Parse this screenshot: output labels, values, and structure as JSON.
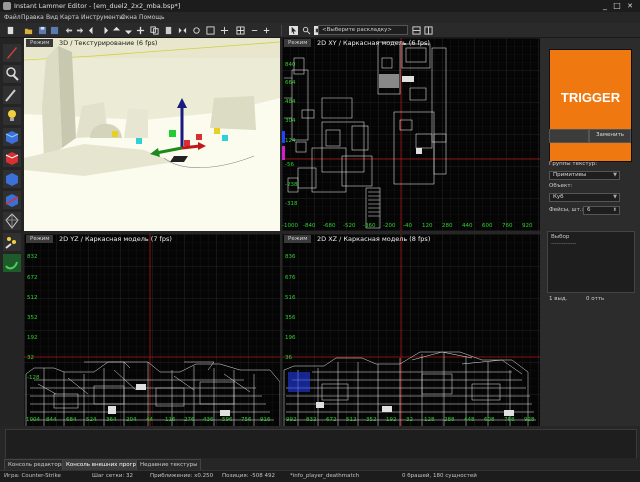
{
  "window": {
    "title": "Instant Lammer Editor - [em_duel2_2x2_mba.bsp*]",
    "min": "_",
    "max": "□",
    "close": "✕"
  },
  "menu": [
    "Файл",
    "Правка",
    "Вид",
    "Карта",
    "Инструменты",
    "Окна",
    "Помощь"
  ],
  "toolbar": {
    "layout_select": "<Выберите раскладку>"
  },
  "viewports": {
    "mode_label": "Режим",
    "v3d": {
      "title": "3D / Текстурирование (6 fps)"
    },
    "top": {
      "title": "2D XY / Каркасная модель (6 fps)",
      "y_labels": [
        "840",
        "664",
        "484",
        "304",
        "124",
        "-56",
        "-238",
        "-318"
      ],
      "x_labels": [
        "-1000",
        "-840",
        "-680",
        "-520",
        "-360",
        "-200",
        "-40",
        "120",
        "280",
        "440",
        "600",
        "760",
        "920"
      ]
    },
    "side_yz": {
      "title": "2D YZ / Каркасная модель (7 fps)",
      "y_labels": [
        "832",
        "672",
        "512",
        "352",
        "192",
        "32",
        "-128"
      ],
      "x_labels": [
        "1004",
        "844",
        "684",
        "524",
        "364",
        "204",
        "44",
        "-116",
        "-276",
        "-436",
        "-596",
        "-756",
        "-916"
      ]
    },
    "side_xz": {
      "title": "2D XZ / Каркасная модель (8 fps)",
      "y_labels": [
        "836",
        "676",
        "516",
        "356",
        "196",
        "36"
      ],
      "x_labels": [
        "-992",
        "-832",
        "-672",
        "-512",
        "-352",
        "-192",
        "-32",
        "128",
        "288",
        "448",
        "608",
        "768",
        "928"
      ]
    }
  },
  "right_panel": {
    "texture_name": "TRIGGER",
    "btn_left": "",
    "btn_replace": "Заменить",
    "texture_groups_label": "Группы текстур:",
    "texture_group_value": "Примитивы",
    "object_label": "Объект:",
    "object_value": "Куб",
    "faces_label": "Фейсы, шт.:",
    "faces_value": "6",
    "selection_title": "Выбор",
    "selection_dashes": "--------------",
    "sel_count": "1 выд.",
    "sel_pct": "0 отть"
  },
  "bottom_tabs": [
    "Консоль редактора",
    "Консоль внешних программ",
    "Недавние текстуры"
  ],
  "status": {
    "game": "Игра: Counter-Strike",
    "grid": "Шаг сетки: 32",
    "zoom": "Приближение: x0.250",
    "position": "Позиция: -508 492",
    "entity": "*info_player_deathmatch",
    "counts": "0 брашей, 180 сущностей"
  },
  "colors": {
    "bg": "#262626",
    "grid_label": "#2fd12f",
    "axis_line": "#b01818",
    "texture_orange": "#f07810",
    "ceiling_line": "#d0d040"
  },
  "icons": [
    "app-icon",
    "new-icon",
    "open-icon",
    "save-icon",
    "undo-icon",
    "redo-icon",
    "arrow-left-icon",
    "arrow-right-icon",
    "compile-icon",
    "pointer-icon",
    "paint-icon",
    "light-icon",
    "brush-icon",
    "entity-icon",
    "clip-icon",
    "path-icon"
  ]
}
